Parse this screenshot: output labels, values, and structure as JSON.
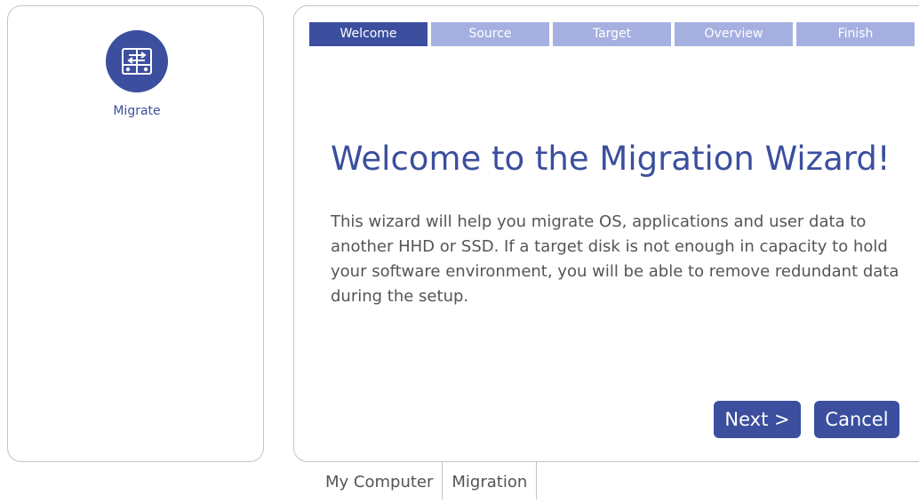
{
  "sidebar": {
    "tool_label": "Migrate"
  },
  "wizard": {
    "steps": [
      "Welcome",
      "Source",
      "Target",
      "Overview",
      "Finish"
    ],
    "active_step": "Welcome",
    "title": "Welcome to the Migration Wizard!",
    "description": "This wizard will help you migrate OS, applications and user data to another HHD or SSD. If a target disk is not enough in capacity to hold your software environment, you will be able to remove redundant data during the setup.",
    "next_label": "Next >",
    "cancel_label": "Cancel"
  },
  "tabs": [
    "My Computer",
    "Migration"
  ],
  "active_tab": "Migration",
  "colors": {
    "accent": "#3b4f9e",
    "step_inactive": "#a6b0e0",
    "text": "#555555",
    "border": "#c4c4c4"
  },
  "icons": {
    "migrate": "migrate-disks-icon"
  }
}
